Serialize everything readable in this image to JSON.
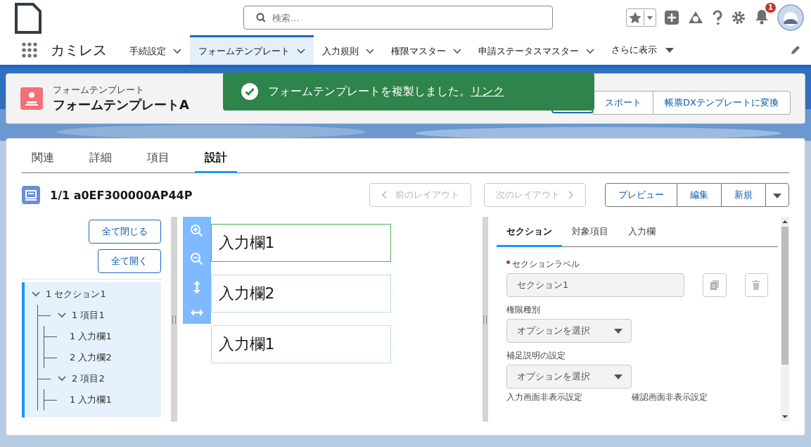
{
  "header": {
    "search": {
      "placeholder": "検索..."
    },
    "notification_count": "1"
  },
  "nav": {
    "app_name": "カミレス",
    "tabs": [
      {
        "label": "手続設定",
        "selected": false
      },
      {
        "label": "フォームテンプレート",
        "selected": true
      },
      {
        "label": "入力規則",
        "selected": false
      },
      {
        "label": "権限マスター",
        "selected": false
      },
      {
        "label": "申請ステータスマスター",
        "selected": false
      }
    ],
    "more": "さらに表示"
  },
  "record": {
    "object_label": "フォームテンプレート",
    "title": "フォームテンプレートA",
    "buttons": [
      "スポート",
      "帳票DXテンプレートに変換"
    ]
  },
  "toast": {
    "message": "フォームテンプレートを複製しました。",
    "link": "リンク"
  },
  "tabs": [
    {
      "label": "関連",
      "selected": false
    },
    {
      "label": "詳細",
      "selected": false
    },
    {
      "label": "項目",
      "selected": false
    },
    {
      "label": "設計",
      "selected": true
    }
  ],
  "layout": {
    "title": "1/1 a0EF300000AP44P",
    "prev": {
      "label": "前のレイアウト",
      "disabled": true
    },
    "next": {
      "label": "次のレイアウト",
      "disabled": true
    },
    "actions": [
      "プレビュー",
      "編集",
      "新規"
    ]
  },
  "tree": {
    "collapse_all": "全て閉じる",
    "expand_all": "全て開く",
    "items": [
      {
        "label": "1 セクション1",
        "expanded": true,
        "children": [
          {
            "label": "1 項目1",
            "expanded": true,
            "children": [
              {
                "label": "1 入力欄1"
              },
              {
                "label": "2 入力欄2"
              }
            ]
          },
          {
            "label": "2 項目2",
            "expanded": true,
            "children": [
              {
                "label": "1 入力欄1"
              }
            ]
          }
        ]
      }
    ]
  },
  "canvas": {
    "fields": [
      {
        "label": "入力欄1",
        "selected": true
      },
      {
        "label": "入力欄2",
        "selected": false
      },
      {
        "label": "入力欄1",
        "selected": false
      }
    ]
  },
  "properties": {
    "tabs": [
      {
        "label": "セクション",
        "selected": true
      },
      {
        "label": "対象項目",
        "selected": false
      },
      {
        "label": "入力欄",
        "selected": false
      }
    ],
    "fields": [
      {
        "kind": "text",
        "label": "セクションラベル",
        "required": true,
        "value": "セクション1"
      },
      {
        "kind": "select",
        "label": "権限種別",
        "required": false,
        "placeholder": "オプションを選択"
      },
      {
        "kind": "select",
        "label": "補足説明の設定",
        "required": false,
        "placeholder": "オプションを選択"
      }
    ],
    "bottom_labels": [
      "入力画面非表示設定",
      "確認画面非表示設定"
    ]
  }
}
